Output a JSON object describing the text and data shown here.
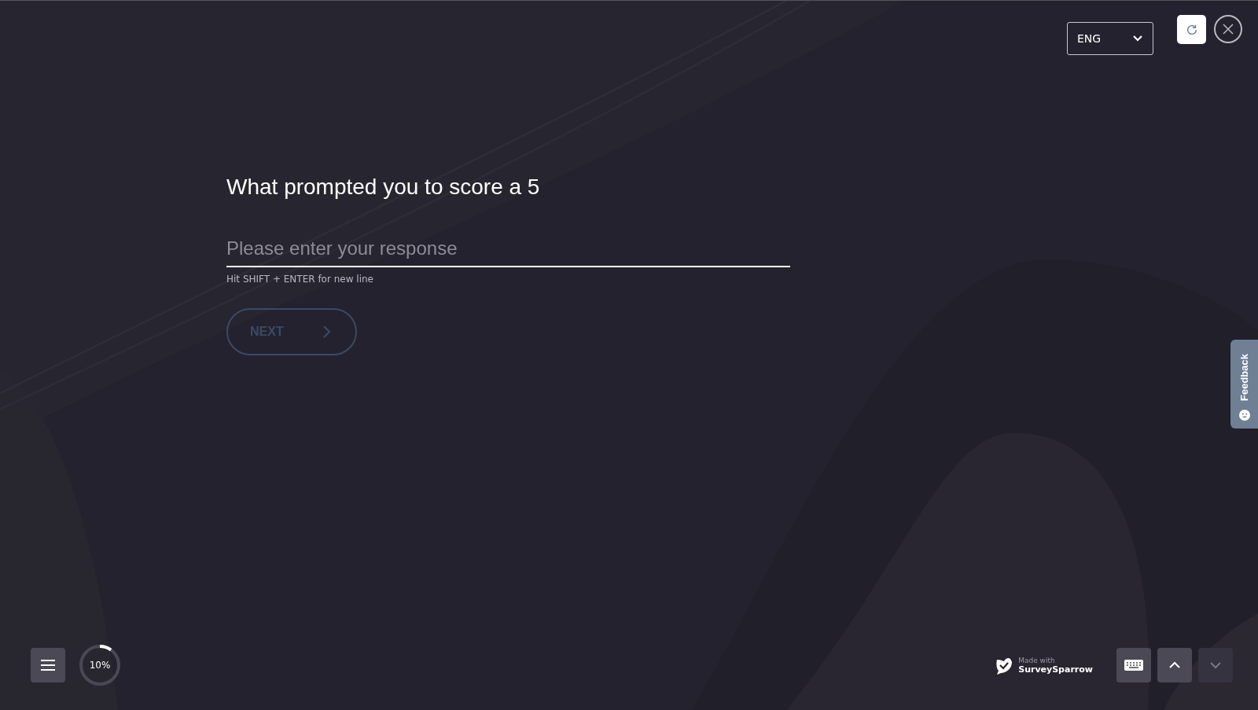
{
  "language_select": {
    "value": "ENG"
  },
  "question": {
    "title": "What prompted you to score a 5",
    "placeholder": "Please enter your response",
    "hint": "Hit SHIFT + ENTER for new line"
  },
  "next_button": {
    "label": "NEXT",
    "disabled": true
  },
  "feedback_tab": {
    "label": "Feedback"
  },
  "progress": {
    "label": "10%"
  },
  "branding": {
    "line_1": "Made with",
    "line_2": "SurveySparrow"
  },
  "nav": {
    "up_disabled": false,
    "down_disabled": true
  }
}
